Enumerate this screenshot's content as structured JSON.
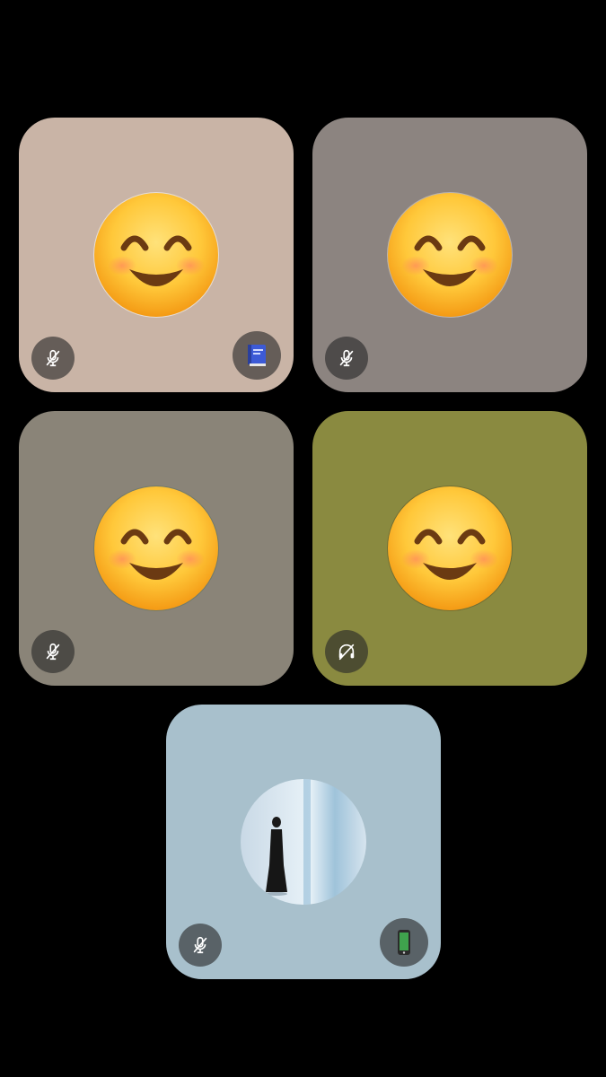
{
  "participants": [
    {
      "tile_color": "#c9b4a6",
      "avatar": "smiling-face-emoji",
      "status_icon": "mic-off-icon",
      "device_icon": "book-icon"
    },
    {
      "tile_color": "#8c8480",
      "avatar": "smiling-face-emoji",
      "status_icon": "mic-off-icon"
    },
    {
      "tile_color": "#8a8478",
      "avatar": "smiling-face-emoji",
      "status_icon": "mic-off-icon"
    },
    {
      "tile_color": "#8a8a40",
      "avatar": "smiling-face-emoji",
      "status_icon": "headphones-off-icon"
    },
    {
      "tile_color": "#a8c0cc",
      "avatar": "person-photo",
      "status_icon": "mic-off-icon",
      "device_icon": "mobile-phone-icon"
    }
  ]
}
